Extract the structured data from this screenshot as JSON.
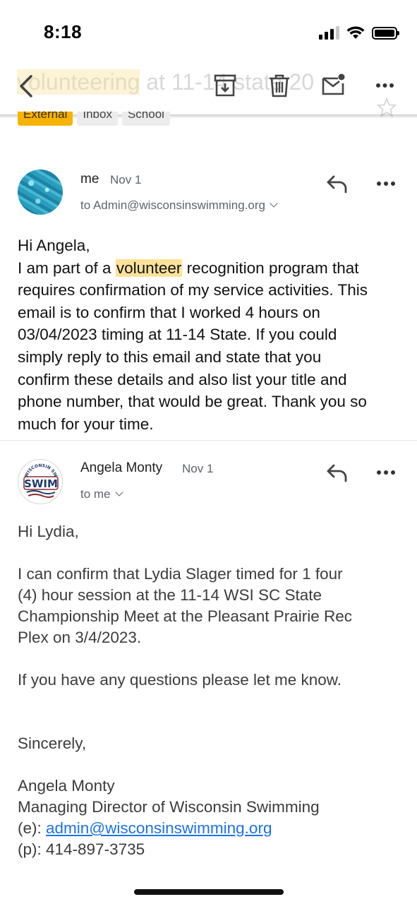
{
  "status_bar": {
    "time": "8:18"
  },
  "header": {
    "subject_highlight": "volunteering",
    "subject_rest": " at 11-14 state 2023",
    "icons": [
      "back-arrow-icon",
      "archive-icon",
      "trash-icon",
      "mark-unread-icon",
      "more-icon",
      "star-icon"
    ]
  },
  "labels": [
    "External",
    "Inbox",
    "School"
  ],
  "messages": [
    {
      "sender": "me",
      "date": "Nov 1",
      "to": "to Admin@wisconsinswimming.org",
      "body": {
        "greeting": "Hi Angela,",
        "line1_pre": "I am part of a ",
        "line1_mark": "volunteer",
        "line1_post": " recognition program that",
        "line2": "requires confirmation of my service activities. This",
        "line3": "email is to confirm that I worked 4 hours on",
        "line4": "03/04/2023 timing at 11-14 State. If you could",
        "line5": "simply reply to this email and state that you",
        "line6": "confirm these details and also list your title and",
        "line7": "phone number, that would be great. Thank you so",
        "line8": "much for your time."
      }
    },
    {
      "sender": "Angela Monty",
      "date": "Nov 1",
      "to": "to me",
      "logo_text": "SWIM",
      "logo_arc_text": "WISCONSIN SWIMMING",
      "body": {
        "greeting": "Hi Lydia,",
        "p1_l1": "I can confirm that Lydia Slager timed for 1 four",
        "p1_l2": "(4) hour session at the 11-14 WSI SC State",
        "p1_l3": "Championship Meet at the Pleasant Prairie Rec",
        "p1_l4": "Plex on 3/4/2023.",
        "p2": "If you have any questions please let me know.",
        "closing": "Sincerely,",
        "sig_name": "Angela Monty",
        "sig_title": "Managing Director of Wisconsin Swimming",
        "sig_email_label": "(e): ",
        "sig_email": "admin@wisconsinswimming.org",
        "sig_phone": "(p): 414-897-3735"
      }
    }
  ],
  "colors": {
    "accent_link": "#1a73e8",
    "label_external": "#f6b400",
    "highlight": "#fde29a"
  }
}
